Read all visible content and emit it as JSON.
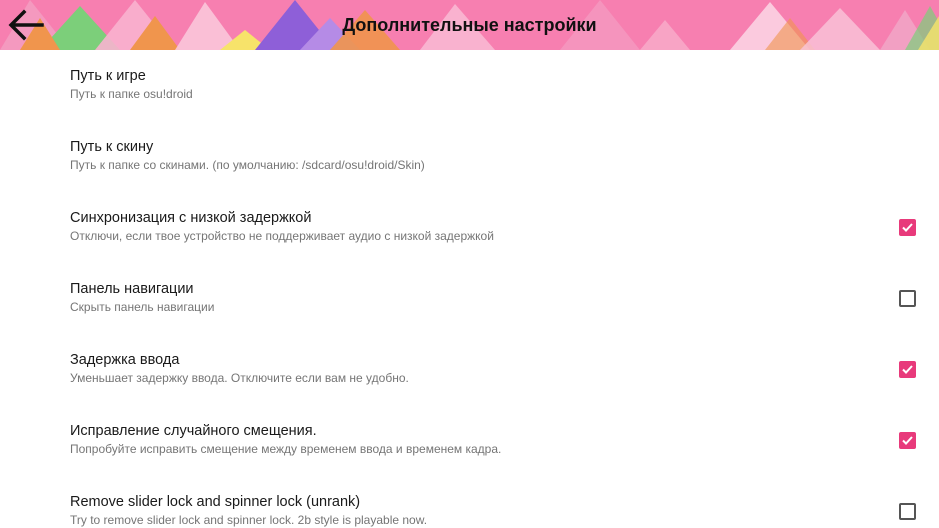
{
  "header": {
    "title": "Дополнительные настройки",
    "back_icon": "arrow-left-icon",
    "accent_colors": [
      "#f77fb0",
      "#8e5fd8",
      "#7ccf7a",
      "#f0954d",
      "#f7e36a"
    ]
  },
  "settings": [
    {
      "title": "Путь к игре",
      "summary": "Путь к папке osu!droid",
      "has_checkbox": false
    },
    {
      "title": "Путь к скину",
      "summary": "Путь к папке со скинами. (по умолчанию: /sdcard/osu!droid/Skin)",
      "has_checkbox": false
    },
    {
      "title": "Синхронизация с низкой задержкой",
      "summary": "Отключи, если твое устройство не поддерживает аудио с низкой задержкой",
      "has_checkbox": true,
      "checked": true
    },
    {
      "title": "Панель навигации",
      "summary": "Скрыть панель навигации",
      "has_checkbox": true,
      "checked": false
    },
    {
      "title": "Задержка ввода",
      "summary": "Уменьшает задержку ввода. Отключите если вам не удобно.",
      "has_checkbox": true,
      "checked": true
    },
    {
      "title": "Исправление случайного смещения.",
      "summary": "Попробуйте исправить смещение между временем ввода и временем кадра.",
      "has_checkbox": true,
      "checked": true
    },
    {
      "title": "Remove slider lock and spinner lock (unrank)",
      "summary": "Try to remove slider lock and spinner lock. 2b style is playable now.",
      "has_checkbox": true,
      "checked": false
    }
  ],
  "colors": {
    "checkbox_checked": "#e83a7b",
    "checkbox_unchecked_border": "#555555",
    "title_text": "#1a1a1a",
    "summary_text": "#757575"
  }
}
